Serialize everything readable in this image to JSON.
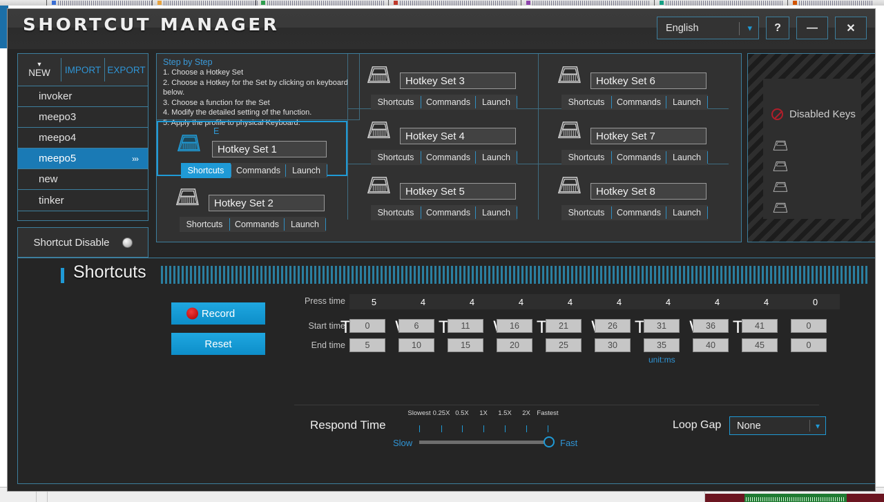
{
  "window": {
    "title": "SHORTCUT MANAGER",
    "language": "English",
    "help_label": "?",
    "minimize_label": "—",
    "close_label": "✕"
  },
  "sidebar": {
    "toolbar": {
      "new": "NEW",
      "import": "IMPORT",
      "export": "EXPORT"
    },
    "profiles": [
      {
        "label": "invoker",
        "selected": false
      },
      {
        "label": "meepo3",
        "selected": false
      },
      {
        "label": "meepo4",
        "selected": false
      },
      {
        "label": "meepo5",
        "selected": true,
        "chevron": "›››"
      },
      {
        "label": "new",
        "selected": false
      },
      {
        "label": "tinker",
        "selected": false
      }
    ],
    "shortcut_disable": {
      "label": "Shortcut Disable",
      "state": "off"
    }
  },
  "steps": {
    "heading": "Step by Step",
    "items": [
      "1. Choose a Hotkey Set",
      "2. Choose a Hotkey for the Set by clicking on keyboard below.",
      "3. Choose a function for the Set",
      "4. Modify the detailed setting of the function.",
      "5. Apply the profile to physical Keyboard."
    ]
  },
  "hotkey_sets": {
    "tabs": {
      "shortcuts": "Shortcuts",
      "commands": "Commands",
      "launch": "Launch"
    },
    "items": [
      {
        "name": "Hotkey Set 1",
        "key": "E",
        "selected": true,
        "active_tab": "Shortcuts"
      },
      {
        "name": "Hotkey Set 2",
        "key": "",
        "selected": false,
        "active_tab": ""
      },
      {
        "name": "Hotkey Set 3",
        "key": "",
        "selected": false,
        "active_tab": ""
      },
      {
        "name": "Hotkey Set 4",
        "key": "",
        "selected": false,
        "active_tab": ""
      },
      {
        "name": "Hotkey Set 5",
        "key": "",
        "selected": false,
        "active_tab": ""
      },
      {
        "name": "Hotkey Set 6",
        "key": "",
        "selected": false,
        "active_tab": ""
      },
      {
        "name": "Hotkey Set 7",
        "key": "",
        "selected": false,
        "active_tab": ""
      },
      {
        "name": "Hotkey Set 8",
        "key": "",
        "selected": false,
        "active_tab": ""
      }
    ]
  },
  "disabled_keys": {
    "label": "Disabled Keys",
    "slots": 4
  },
  "shortcuts": {
    "title": "Shortcuts",
    "record_label": "Record",
    "reset_label": "Reset",
    "labels": {
      "press_time": "Press time",
      "start_time": "Start time",
      "end_time": "End time",
      "unit": "unit:ms"
    },
    "sequence": [
      {
        "key": "Tab",
        "press": "5",
        "start": "0",
        "end": "5"
      },
      {
        "key": "W",
        "press": "4",
        "start": "6",
        "end": "10"
      },
      {
        "key": "Tab",
        "press": "4",
        "start": "11",
        "end": "15"
      },
      {
        "key": "W",
        "press": "4",
        "start": "16",
        "end": "20"
      },
      {
        "key": "Tab",
        "press": "4",
        "start": "21",
        "end": "25"
      },
      {
        "key": "W",
        "press": "4",
        "start": "26",
        "end": "30"
      },
      {
        "key": "Tab",
        "press": "4",
        "start": "31",
        "end": "35"
      },
      {
        "key": "W",
        "press": "4",
        "start": "36",
        "end": "40"
      },
      {
        "key": "Tab",
        "press": "4",
        "start": "41",
        "end": "45"
      },
      {
        "key": "",
        "press": "0",
        "start": "0",
        "end": "0"
      }
    ],
    "respond_time": {
      "label": "Respond Time",
      "slow_label": "Slow",
      "fast_label": "Fast",
      "ticks": [
        "Slowest",
        "0.25X",
        "0.5X",
        "1X",
        "1.5X",
        "2X",
        "Fastest"
      ],
      "value_index": 6
    },
    "loop_gap": {
      "label": "Loop Gap",
      "value": "None"
    }
  },
  "colors": {
    "accent": "#1f9ad6",
    "accent_dark": "#0d8ec9",
    "selection": "#1a7ab5",
    "panel": "#313131",
    "background": "#252525",
    "border": "#3d7f9e",
    "record_dot": "#c01111",
    "disabled_red": "#b11e2a"
  }
}
